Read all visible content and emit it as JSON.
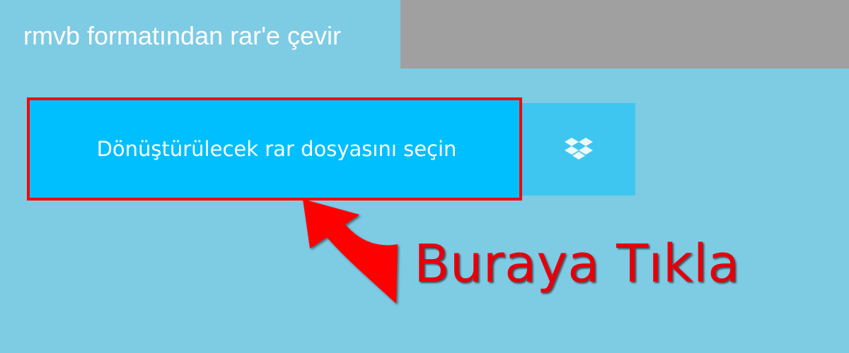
{
  "page": {
    "title": "rmvb formatından rar'e çevir"
  },
  "upload": {
    "choose_file_label": "Dönüştürülecek rar dosyasını seçin",
    "cloud_source_icon": "dropbox-icon"
  },
  "annotation": {
    "text": "Buraya Tıkla",
    "color": "#e4000b",
    "frame_color": "#ff0000"
  },
  "colors": {
    "background": "#7ecbe4",
    "header_block": "#a0a0a0",
    "primary_button": "#00bfff",
    "secondary_button": "#3fc6f0"
  }
}
